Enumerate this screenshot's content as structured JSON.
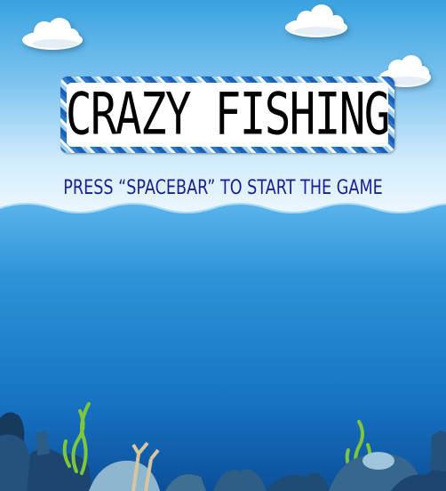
{
  "game": {
    "title": "CRAZY FISHING",
    "prompt": "PRESS “SPACEBAR” TO START THE GAME"
  },
  "colors": {
    "sky_top": "#3aa2e0",
    "sky_bottom": "#f6fbff",
    "water_top": "#59b2ea",
    "water_deep": "#0f5aa8",
    "prompt_text": "#1c1f8f",
    "title_text": "#000000",
    "title_border": "#1f5fb2"
  },
  "icons": [
    "cloud-icon",
    "seaweed-icon",
    "coral-icon",
    "rock-icon"
  ]
}
